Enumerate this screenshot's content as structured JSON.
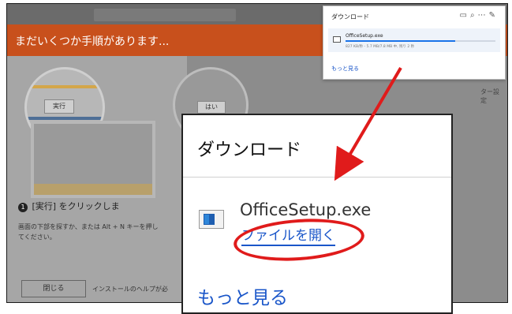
{
  "background": {
    "banner_title": "まだいくつか手順があります...",
    "run_button": "実行",
    "yes_button": "はい",
    "step_label": "[実行] をクリックしま",
    "step_number": "1",
    "step_desc": "画面の下部を探すか、または Alt + N キーを押してください。",
    "close_button": "閉じる",
    "help_text": "インストールのヘルプが必",
    "right_chip": "ター設定"
  },
  "mini_panel": {
    "title": "ダウンロード",
    "filename": "OfficeSetup.exe",
    "status": "827 KB/秒 - 5.7 MB/7.8 MB 中, 残り 2 秒",
    "progress": 0.73,
    "more_link": "もっと見る"
  },
  "zoom_panel": {
    "title": "ダウンロード",
    "filename": "OfficeSetup.exe",
    "open_link": "ファイルを開く",
    "more_link": "もっと見る"
  },
  "annotation": {
    "color": "#e01b1b"
  }
}
